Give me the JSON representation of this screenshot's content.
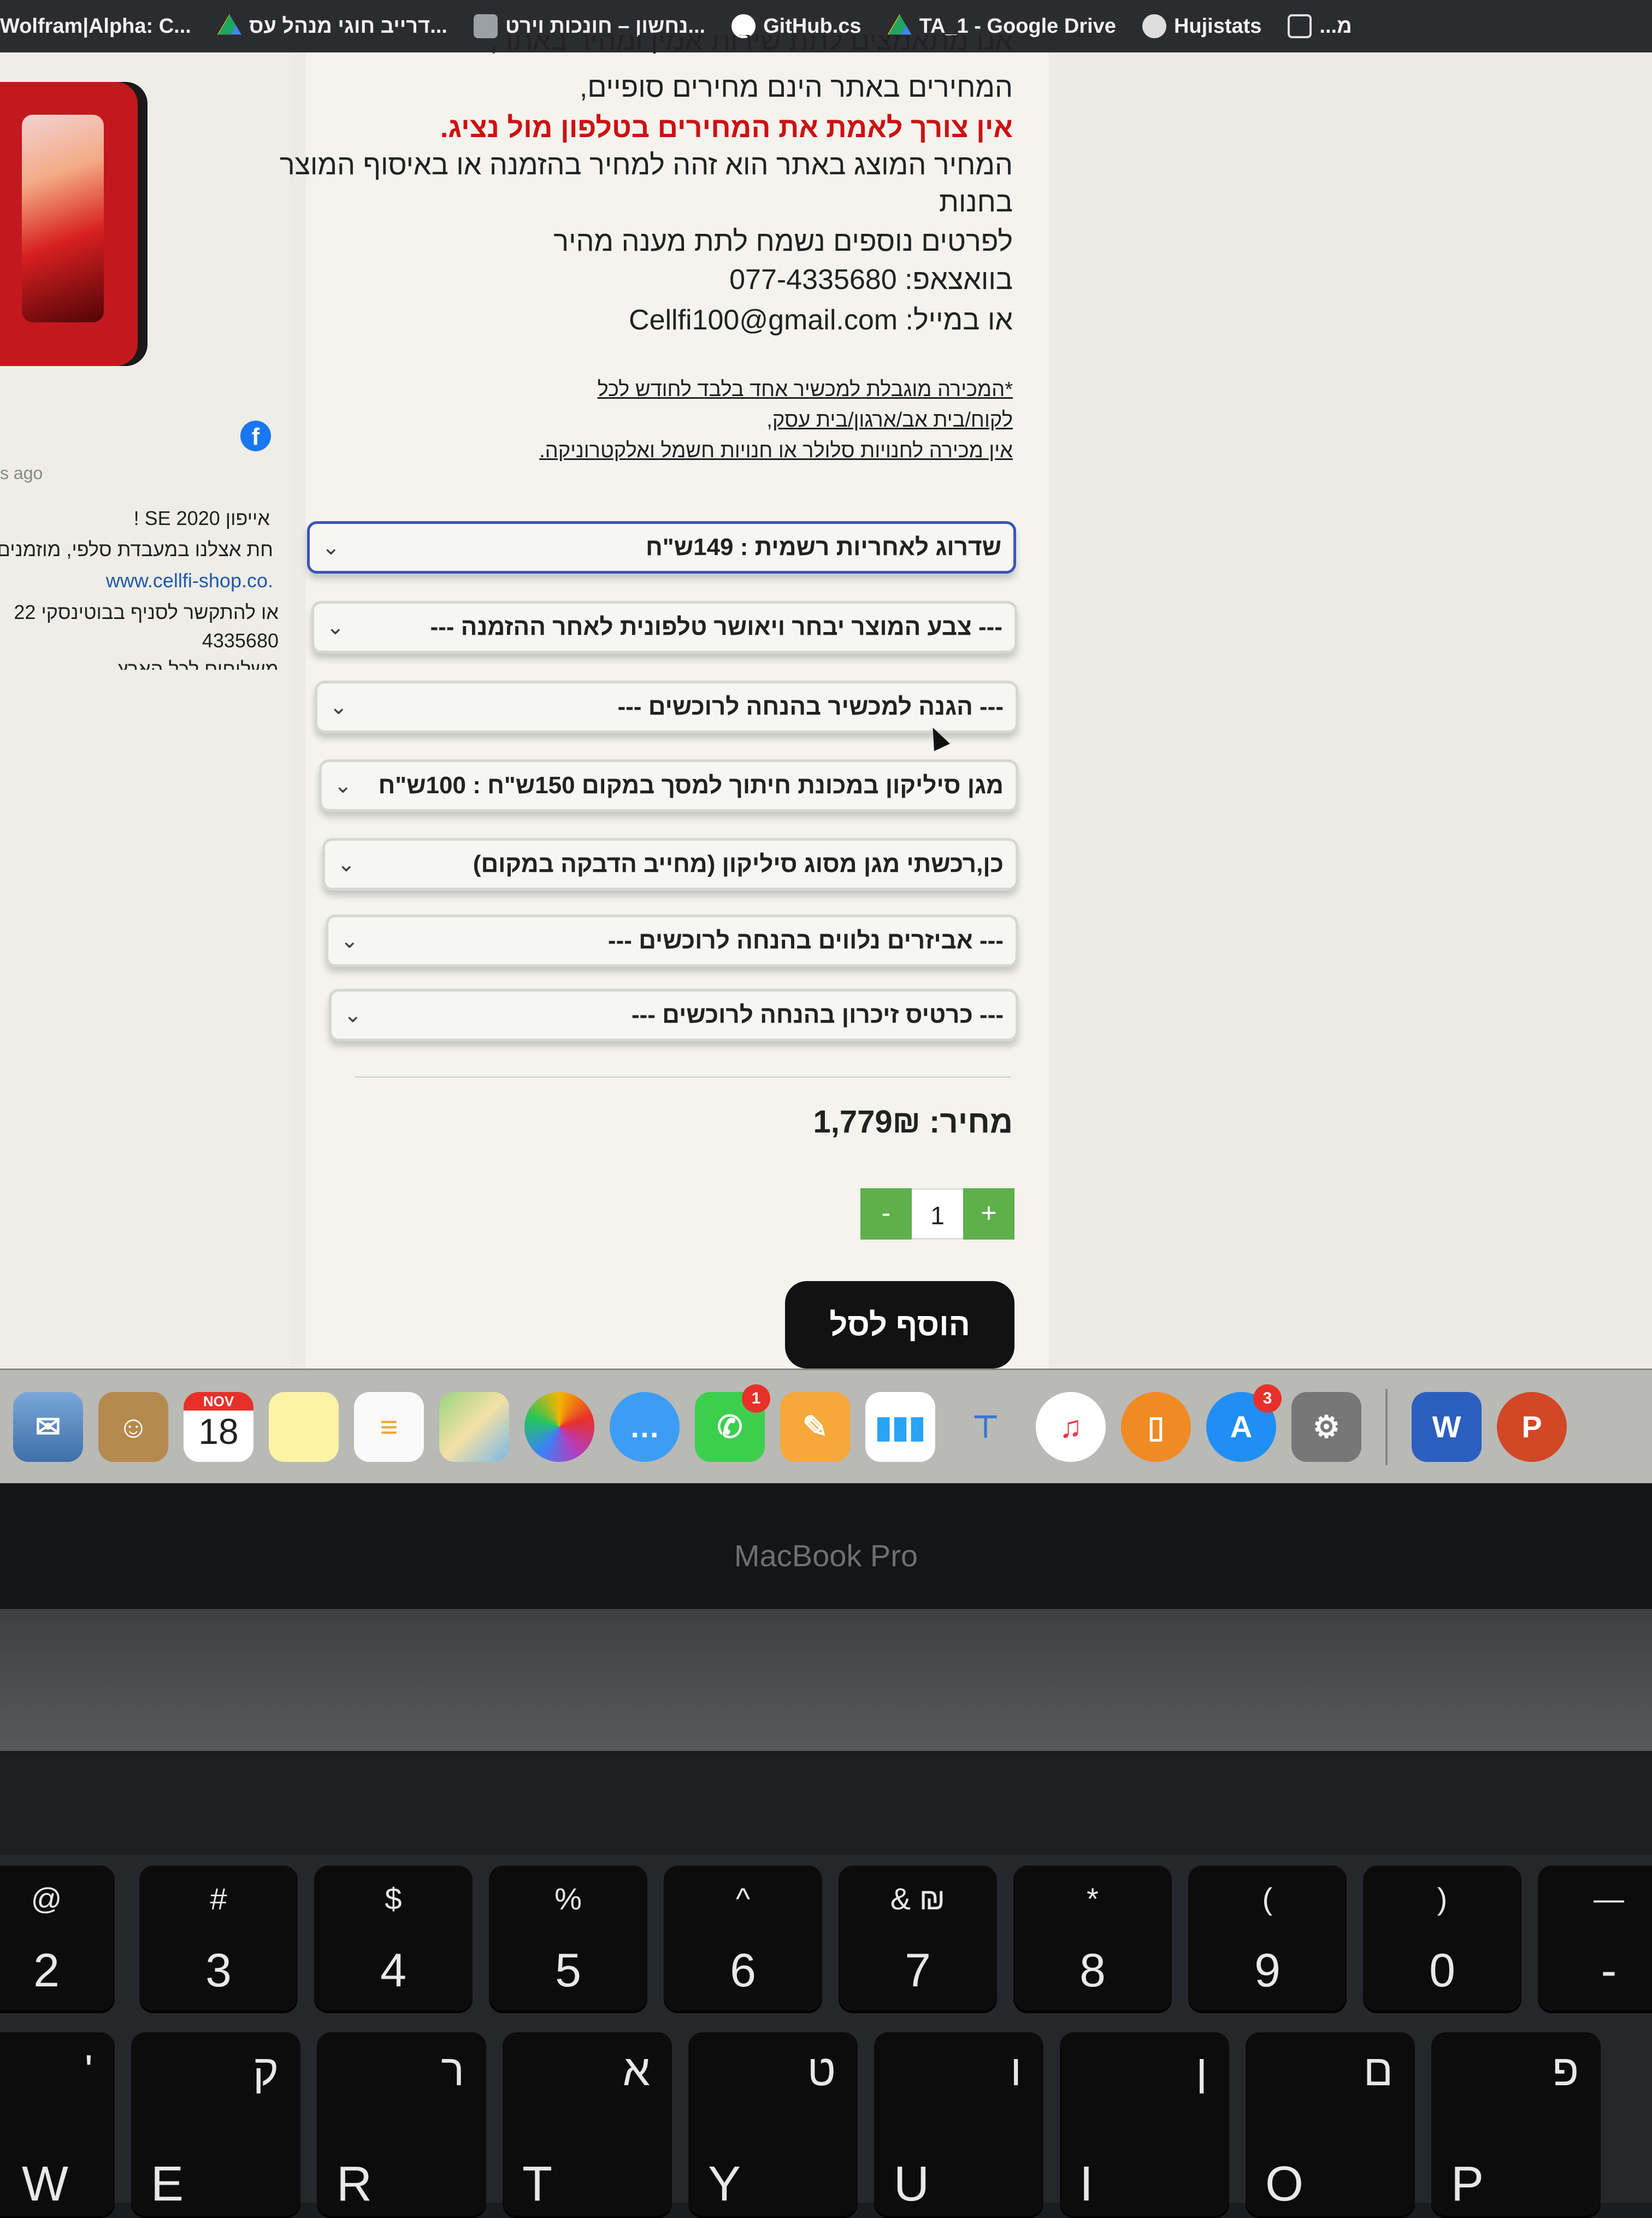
{
  "bookmarks": [
    {
      "label": "Wolfram|Alpha: C...",
      "icon": "wolfram-icon",
      "color": "#2b2c30"
    },
    {
      "label": "דרייב חוגי מנהל עס...",
      "icon": "google-drive-icon",
      "color": "#1fa463"
    },
    {
      "label": "נחשון – חונכות וירט...",
      "icon": "document-icon",
      "color": "#9aa0a6"
    },
    {
      "label": "GitHub.cs",
      "icon": "github-icon",
      "color": "#ffffff"
    },
    {
      "label": "TA_1 - Google Drive",
      "icon": "google-drive-icon",
      "color": "#1fa463"
    },
    {
      "label": "Hujistats",
      "icon": "globe-icon",
      "color": "#dddddd"
    },
    {
      "label": "...מ",
      "icon": "inbox-icon",
      "color": "#dddddd"
    }
  ],
  "sidebar": {
    "time_ago": "s ago",
    "post_title": "אייפון SE 2020 !",
    "post_line2": "חת אצלנו במעבדת סלפי, מוזמנים",
    "post_link": "www.cellfi-shop.co.",
    "post_line4": "או להתקשר לסניף בבוטינסקי 22",
    "post_phone": "4335680",
    "post_line6": "משלוחים לכל הארץ"
  },
  "description": {
    "line0": "אנו מתאמצים לתת שירות אמין ומהיר באתר,",
    "line1": "המחירים באתר הינם מחירים סופיים,",
    "line2": "אין צורך לאמת את המחירים בטלפון מול נציג.",
    "line3": "המחיר המוצג באתר הוא זהה למחיר בהזמנה או באיסוף המוצר",
    "line4": "בחנות",
    "line5": "לפרטים נוספים נשמח לתת מענה מהיר",
    "line6": "בוואצאפ: 077-4335680",
    "line7": "או במייל: Cellfi100@gmail.com"
  },
  "fine_print": {
    "line1": "*המכירה מוגבלת למכשיר אחד בלבד לחודש לכל",
    "line2": "לקוח/בית אב/ארגון/בית עסק,",
    "line3": "אין מכירה לחנויות סלולר או חנויות חשמל ואלקטרוניקה."
  },
  "options": [
    {
      "label": "שדרוג לאחריות רשמית : 149ש\"ח",
      "active": true
    },
    {
      "label": "--- צבע המוצר יבחר ויאושר טלפונית לאחר ההזמנה ---",
      "active": false
    },
    {
      "label": "--- הגנה למכשיר בהנחה לרוכשים ---",
      "active": false
    },
    {
      "label": "מגן סיליקון במכונת חיתוך למסך במקום 150ש\"ח : 100ש\"ח",
      "active": false
    },
    {
      "label": "כן,רכשתי מגן מסוג סיליקון (מחייב הדבקה במקום)",
      "active": false
    },
    {
      "label": "--- אביזרים נלווים בהנחה לרוכשים ---",
      "active": false
    },
    {
      "label": "--- כרטיס זיכרון בהנחה לרוכשים ---",
      "active": false
    }
  ],
  "price_label": "מחיר: 1,779₪",
  "quantity": {
    "minus": "-",
    "value": "1",
    "plus": "+"
  },
  "add_to_cart": "הוסף לסל",
  "dock": {
    "calendar_month": "NOV",
    "calendar_day": "18",
    "facetime_badge": "1",
    "appstore_badge": "3",
    "word_letter": "W",
    "powerpoint_letter": "P"
  },
  "laptop_brand": "MacBook Pro",
  "keys_row1": [
    {
      "top": "@",
      "main": "2"
    },
    {
      "top": "#",
      "main": "3"
    },
    {
      "top": "$",
      "main": "4"
    },
    {
      "top": "%",
      "main": "5"
    },
    {
      "top": "^",
      "main": "6"
    },
    {
      "top": "& ₪",
      "main": "7"
    },
    {
      "top": "*",
      "main": "8"
    },
    {
      "top": "(",
      "main": "9"
    },
    {
      "top": ")",
      "main": "0"
    },
    {
      "top": "—",
      "main": "-"
    }
  ],
  "keys_row2": [
    {
      "heb": "'",
      "lat": "W"
    },
    {
      "heb": "ק",
      "lat": "E"
    },
    {
      "heb": "ר",
      "lat": "R"
    },
    {
      "heb": "א",
      "lat": "T"
    },
    {
      "heb": "ט",
      "lat": "Y"
    },
    {
      "heb": "ו",
      "lat": "U"
    },
    {
      "heb": "ן",
      "lat": "I"
    },
    {
      "heb": "ם",
      "lat": "O"
    },
    {
      "heb": "פ",
      "lat": "P"
    }
  ],
  "colors": {
    "accent_green": "#5db04a",
    "warning_red": "#cc1111",
    "active_border": "#3a55b8"
  }
}
